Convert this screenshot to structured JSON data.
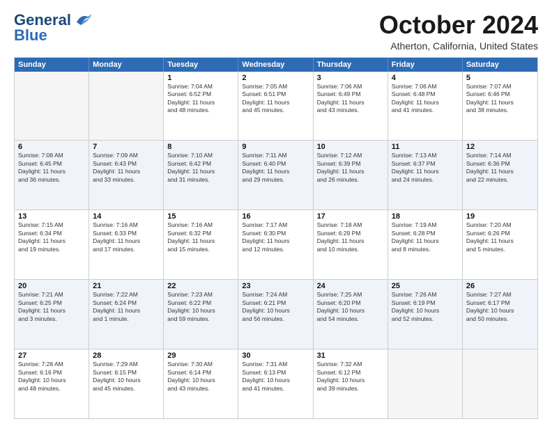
{
  "logo": {
    "text_general": "General",
    "text_blue": "Blue"
  },
  "title": "October 2024",
  "location": "Atherton, California, United States",
  "days_of_week": [
    "Sunday",
    "Monday",
    "Tuesday",
    "Wednesday",
    "Thursday",
    "Friday",
    "Saturday"
  ],
  "weeks": [
    [
      {
        "day": "",
        "empty": true
      },
      {
        "day": "",
        "empty": true
      },
      {
        "day": "1",
        "lines": [
          "Sunrise: 7:04 AM",
          "Sunset: 6:52 PM",
          "Daylight: 11 hours",
          "and 48 minutes."
        ]
      },
      {
        "day": "2",
        "lines": [
          "Sunrise: 7:05 AM",
          "Sunset: 6:51 PM",
          "Daylight: 11 hours",
          "and 45 minutes."
        ]
      },
      {
        "day": "3",
        "lines": [
          "Sunrise: 7:06 AM",
          "Sunset: 6:49 PM",
          "Daylight: 11 hours",
          "and 43 minutes."
        ]
      },
      {
        "day": "4",
        "lines": [
          "Sunrise: 7:06 AM",
          "Sunset: 6:48 PM",
          "Daylight: 11 hours",
          "and 41 minutes."
        ]
      },
      {
        "day": "5",
        "lines": [
          "Sunrise: 7:07 AM",
          "Sunset: 6:46 PM",
          "Daylight: 11 hours",
          "and 38 minutes."
        ]
      }
    ],
    [
      {
        "day": "6",
        "lines": [
          "Sunrise: 7:08 AM",
          "Sunset: 6:45 PM",
          "Daylight: 11 hours",
          "and 36 minutes."
        ]
      },
      {
        "day": "7",
        "lines": [
          "Sunrise: 7:09 AM",
          "Sunset: 6:43 PM",
          "Daylight: 11 hours",
          "and 33 minutes."
        ]
      },
      {
        "day": "8",
        "lines": [
          "Sunrise: 7:10 AM",
          "Sunset: 6:42 PM",
          "Daylight: 11 hours",
          "and 31 minutes."
        ]
      },
      {
        "day": "9",
        "lines": [
          "Sunrise: 7:11 AM",
          "Sunset: 6:40 PM",
          "Daylight: 11 hours",
          "and 29 minutes."
        ]
      },
      {
        "day": "10",
        "lines": [
          "Sunrise: 7:12 AM",
          "Sunset: 6:39 PM",
          "Daylight: 11 hours",
          "and 26 minutes."
        ]
      },
      {
        "day": "11",
        "lines": [
          "Sunrise: 7:13 AM",
          "Sunset: 6:37 PM",
          "Daylight: 11 hours",
          "and 24 minutes."
        ]
      },
      {
        "day": "12",
        "lines": [
          "Sunrise: 7:14 AM",
          "Sunset: 6:36 PM",
          "Daylight: 11 hours",
          "and 22 minutes."
        ]
      }
    ],
    [
      {
        "day": "13",
        "lines": [
          "Sunrise: 7:15 AM",
          "Sunset: 6:34 PM",
          "Daylight: 11 hours",
          "and 19 minutes."
        ]
      },
      {
        "day": "14",
        "lines": [
          "Sunrise: 7:16 AM",
          "Sunset: 6:33 PM",
          "Daylight: 11 hours",
          "and 17 minutes."
        ]
      },
      {
        "day": "15",
        "lines": [
          "Sunrise: 7:16 AM",
          "Sunset: 6:32 PM",
          "Daylight: 11 hours",
          "and 15 minutes."
        ]
      },
      {
        "day": "16",
        "lines": [
          "Sunrise: 7:17 AM",
          "Sunset: 6:30 PM",
          "Daylight: 11 hours",
          "and 12 minutes."
        ]
      },
      {
        "day": "17",
        "lines": [
          "Sunrise: 7:18 AM",
          "Sunset: 6:29 PM",
          "Daylight: 11 hours",
          "and 10 minutes."
        ]
      },
      {
        "day": "18",
        "lines": [
          "Sunrise: 7:19 AM",
          "Sunset: 6:28 PM",
          "Daylight: 11 hours",
          "and 8 minutes."
        ]
      },
      {
        "day": "19",
        "lines": [
          "Sunrise: 7:20 AM",
          "Sunset: 6:26 PM",
          "Daylight: 11 hours",
          "and 5 minutes."
        ]
      }
    ],
    [
      {
        "day": "20",
        "lines": [
          "Sunrise: 7:21 AM",
          "Sunset: 6:25 PM",
          "Daylight: 11 hours",
          "and 3 minutes."
        ]
      },
      {
        "day": "21",
        "lines": [
          "Sunrise: 7:22 AM",
          "Sunset: 6:24 PM",
          "Daylight: 11 hours",
          "and 1 minute."
        ]
      },
      {
        "day": "22",
        "lines": [
          "Sunrise: 7:23 AM",
          "Sunset: 6:22 PM",
          "Daylight: 10 hours",
          "and 59 minutes."
        ]
      },
      {
        "day": "23",
        "lines": [
          "Sunrise: 7:24 AM",
          "Sunset: 6:21 PM",
          "Daylight: 10 hours",
          "and 56 minutes."
        ]
      },
      {
        "day": "24",
        "lines": [
          "Sunrise: 7:25 AM",
          "Sunset: 6:20 PM",
          "Daylight: 10 hours",
          "and 54 minutes."
        ]
      },
      {
        "day": "25",
        "lines": [
          "Sunrise: 7:26 AM",
          "Sunset: 6:19 PM",
          "Daylight: 10 hours",
          "and 52 minutes."
        ]
      },
      {
        "day": "26",
        "lines": [
          "Sunrise: 7:27 AM",
          "Sunset: 6:17 PM",
          "Daylight: 10 hours",
          "and 50 minutes."
        ]
      }
    ],
    [
      {
        "day": "27",
        "lines": [
          "Sunrise: 7:28 AM",
          "Sunset: 6:16 PM",
          "Daylight: 10 hours",
          "and 48 minutes."
        ]
      },
      {
        "day": "28",
        "lines": [
          "Sunrise: 7:29 AM",
          "Sunset: 6:15 PM",
          "Daylight: 10 hours",
          "and 45 minutes."
        ]
      },
      {
        "day": "29",
        "lines": [
          "Sunrise: 7:30 AM",
          "Sunset: 6:14 PM",
          "Daylight: 10 hours",
          "and 43 minutes."
        ]
      },
      {
        "day": "30",
        "lines": [
          "Sunrise: 7:31 AM",
          "Sunset: 6:13 PM",
          "Daylight: 10 hours",
          "and 41 minutes."
        ]
      },
      {
        "day": "31",
        "lines": [
          "Sunrise: 7:32 AM",
          "Sunset: 6:12 PM",
          "Daylight: 10 hours",
          "and 39 minutes."
        ]
      },
      {
        "day": "",
        "empty": true
      },
      {
        "day": "",
        "empty": true
      }
    ]
  ]
}
